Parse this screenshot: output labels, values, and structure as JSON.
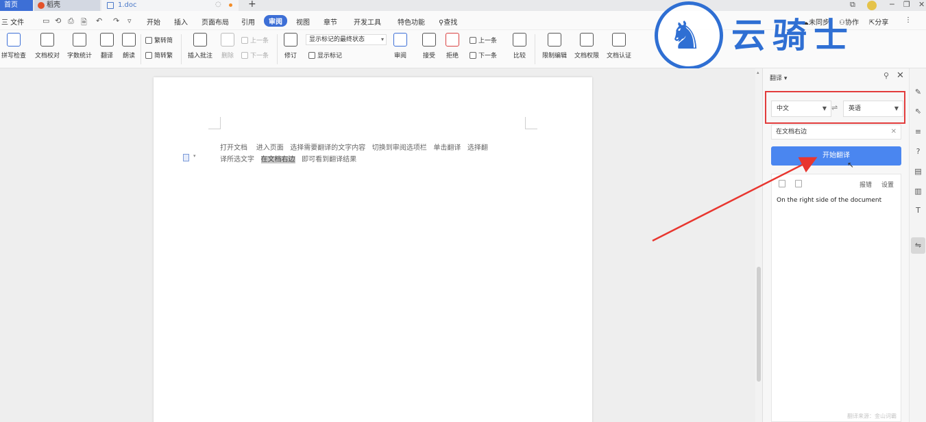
{
  "titlebar": {
    "tabs": [
      {
        "label": "首页"
      },
      {
        "label": "稻壳"
      },
      {
        "label": "1.doc"
      }
    ],
    "add_tab": "+",
    "window_controls": [
      "─",
      "❐",
      "✕"
    ]
  },
  "menubar": {
    "file_label": "三 文件",
    "items": [
      "开始",
      "插入",
      "页面布局",
      "引用",
      "审阅",
      "视图",
      "章节",
      "开发工具",
      "特色功能"
    ],
    "active_item": "审阅",
    "search_label": "查找",
    "sync_label": "未同步",
    "collab_label": "协作",
    "share_label": "分享"
  },
  "ribbon": {
    "spellcheck": "拼写检查",
    "doc_proof": "文档校对",
    "word_count": "字数统计",
    "translate": "翻译",
    "read_aloud": "朗读",
    "trad_to_simp": "繁转简",
    "simp_to_trad": "简转繁",
    "insert_comment": "插入批注",
    "delete": "删除",
    "prev_comment": "上一条",
    "next_comment": "下一条",
    "track_changes": "修订",
    "markup_state": "显示标记的最终状态",
    "show_markup": "显示标记",
    "review": "审阅",
    "accept": "接受",
    "reject": "拒绝",
    "prev_change": "上一条",
    "next_change": "下一条",
    "compare": "比较",
    "restrict_edit": "限制编辑",
    "doc_rights": "文档权限",
    "doc_auth": "文档认证"
  },
  "logo": {
    "text": "云骑士"
  },
  "document": {
    "line1": "打开文档    进入页面   选择需要翻译的文字内容   切换到审阅选项栏   单击翻译   选择翻",
    "line2_prefix": "译所选文字   ",
    "highlight": "在文档右边",
    "line2_suffix": "   即可看到翻译结果"
  },
  "translate_panel": {
    "title": "翻译",
    "source_lang": "中文",
    "target_lang": "英语",
    "source_text": "在文档右边",
    "translate_button": "开始翻译",
    "report_error": "报错",
    "settings": "设置",
    "result": "On the right side of the document",
    "source_credit": "翻译来源：金山词霸"
  },
  "colors": {
    "accent": "#3d6fd6",
    "button": "#4a86f0",
    "highlight_frame": "#e23b3b",
    "logo_blue": "#2f6fd3"
  }
}
